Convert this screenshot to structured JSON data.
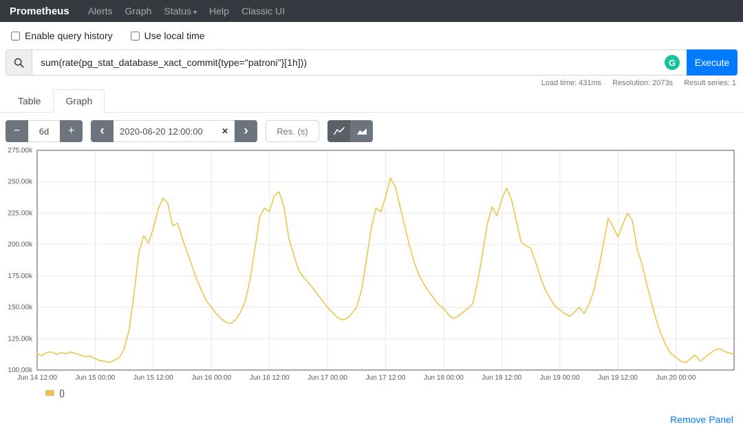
{
  "navbar": {
    "brand": "Prometheus",
    "items": [
      {
        "label": "Alerts"
      },
      {
        "label": "Graph"
      },
      {
        "label": "Status"
      },
      {
        "label": "Help"
      },
      {
        "label": "Classic UI"
      }
    ]
  },
  "options": {
    "query_history_label": "Enable query history",
    "local_time_label": "Use local time"
  },
  "query": {
    "expression": "sum(rate(pg_stat_database_xact_commit{type=\"patroni\"}[1h]))",
    "execute_label": "Execute"
  },
  "stats": {
    "load_time": "Load time: 431ms",
    "resolution": "Resolution: 2073s",
    "result_series": "Result series: 1"
  },
  "tabs": [
    {
      "label": "Table"
    },
    {
      "label": "Graph"
    }
  ],
  "controls": {
    "range_value": "6d",
    "datetime_value": "2020-06-20 12:00:00",
    "res_placeholder": "Res. (s)"
  },
  "icons": {
    "caret_down": "▾",
    "minus": "−",
    "plus": "+",
    "chevron_left": "‹",
    "chevron_right": "›",
    "clear": "✕",
    "grammarly": "G"
  },
  "legend": {
    "series_label": "{}"
  },
  "footer": {
    "remove_panel_label": "Remove Panel"
  },
  "colors": {
    "accent_blue": "#007bff",
    "series_yellow": "#edc240",
    "navbar_dark": "#343a40",
    "grammarly_green": "#15c39a"
  },
  "chart_data": {
    "type": "line",
    "title": "",
    "xlabel": "",
    "ylabel": "",
    "grid": true,
    "legend": [
      "{}"
    ],
    "xlim_hours": [
      0,
      144
    ],
    "ylim_k": [
      100,
      275
    ],
    "x_tick_hours": [
      0,
      12,
      24,
      36,
      48,
      60,
      72,
      84,
      96,
      108,
      120,
      132
    ],
    "x_tick_labels": [
      "Jun 14 12:00",
      "Jun 15 00:00",
      "Jun 15 12:00",
      "Jun 16 00:00",
      "Jun 16 12:00",
      "Jun 17 00:00",
      "Jun 17 12:00",
      "Jun 18 00:00",
      "Jun 18 12:00",
      "Jun 19 00:00",
      "Jun 19 12:00",
      "Jun 20 00:00"
    ],
    "y_ticks_k": [
      100,
      125,
      150,
      175,
      200,
      225,
      250,
      275
    ],
    "y_tick_labels": [
      "100.00k",
      "125.00k",
      "150.00k",
      "175.00k",
      "200.00k",
      "225.00k",
      "250.00k",
      "275.00k"
    ],
    "series": [
      {
        "name": "{}",
        "color": "#edc240",
        "points": [
          [
            0,
            113
          ],
          [
            1,
            111.5
          ],
          [
            2,
            114
          ],
          [
            3,
            114.5
          ],
          [
            4,
            112.5
          ],
          [
            5,
            114
          ],
          [
            6,
            113
          ],
          [
            7,
            114.5
          ],
          [
            8,
            113
          ],
          [
            9,
            112
          ],
          [
            10,
            110.5
          ],
          [
            11,
            111
          ],
          [
            12,
            109
          ],
          [
            13,
            107.5
          ],
          [
            14,
            107
          ],
          [
            15,
            106
          ],
          [
            16,
            108
          ],
          [
            17,
            110
          ],
          [
            18,
            117
          ],
          [
            19,
            132
          ],
          [
            20,
            160
          ],
          [
            21,
            193
          ],
          [
            22,
            207
          ],
          [
            23,
            201
          ],
          [
            24,
            213
          ],
          [
            25,
            228
          ],
          [
            26,
            237
          ],
          [
            27,
            233
          ],
          [
            28,
            215
          ],
          [
            29,
            217
          ],
          [
            30,
            205
          ],
          [
            31,
            194
          ],
          [
            32,
            183
          ],
          [
            33,
            172
          ],
          [
            34,
            163
          ],
          [
            35,
            155
          ],
          [
            36,
            150
          ],
          [
            37,
            145
          ],
          [
            38,
            141
          ],
          [
            39,
            138
          ],
          [
            40,
            137
          ],
          [
            41,
            140
          ],
          [
            42,
            146
          ],
          [
            43,
            155
          ],
          [
            44,
            172
          ],
          [
            45,
            197
          ],
          [
            46,
            222
          ],
          [
            47,
            229
          ],
          [
            48,
            226
          ],
          [
            49,
            239
          ],
          [
            50,
            242
          ],
          [
            51,
            230
          ],
          [
            52,
            205
          ],
          [
            53,
            192
          ],
          [
            54,
            180
          ],
          [
            55,
            174
          ],
          [
            56,
            170
          ],
          [
            57,
            165
          ],
          [
            58,
            160
          ],
          [
            59,
            155
          ],
          [
            60,
            150
          ],
          [
            61,
            146
          ],
          [
            62,
            142
          ],
          [
            63,
            140
          ],
          [
            64,
            141
          ],
          [
            65,
            145
          ],
          [
            66,
            150
          ],
          [
            67,
            163
          ],
          [
            68,
            187
          ],
          [
            69,
            212
          ],
          [
            70,
            229
          ],
          [
            71,
            226
          ],
          [
            72,
            238
          ],
          [
            73,
            253
          ],
          [
            74,
            246
          ],
          [
            75,
            230
          ],
          [
            76,
            214
          ],
          [
            77,
            198
          ],
          [
            78,
            185
          ],
          [
            79,
            175
          ],
          [
            80,
            168
          ],
          [
            81,
            162
          ],
          [
            82,
            157
          ],
          [
            83,
            152
          ],
          [
            84,
            149
          ],
          [
            85,
            144
          ],
          [
            86,
            141
          ],
          [
            87,
            143
          ],
          [
            88,
            146
          ],
          [
            89,
            149
          ],
          [
            90,
            153
          ],
          [
            91,
            170
          ],
          [
            92,
            192
          ],
          [
            93,
            216
          ],
          [
            94,
            230
          ],
          [
            95,
            223
          ],
          [
            96,
            236
          ],
          [
            97,
            245
          ],
          [
            98,
            236
          ],
          [
            99,
            219
          ],
          [
            100,
            202
          ],
          [
            101,
            199
          ],
          [
            102,
            197
          ],
          [
            103,
            186
          ],
          [
            104,
            174
          ],
          [
            105,
            164
          ],
          [
            106,
            157
          ],
          [
            107,
            151
          ],
          [
            108,
            148
          ],
          [
            109,
            145
          ],
          [
            110,
            143
          ],
          [
            111,
            146
          ],
          [
            112,
            150
          ],
          [
            113,
            145
          ],
          [
            114,
            152
          ],
          [
            115,
            163
          ],
          [
            116,
            180
          ],
          [
            117,
            200
          ],
          [
            118,
            221
          ],
          [
            119,
            214
          ],
          [
            120,
            206
          ],
          [
            121,
            216
          ],
          [
            122,
            225
          ],
          [
            123,
            219
          ],
          [
            124,
            196
          ],
          [
            125,
            184
          ],
          [
            126,
            168
          ],
          [
            127,
            153
          ],
          [
            128,
            139
          ],
          [
            129,
            128
          ],
          [
            130,
            119
          ],
          [
            131,
            113
          ],
          [
            132,
            110
          ],
          [
            133,
            107
          ],
          [
            134,
            106
          ],
          [
            135,
            109
          ],
          [
            136,
            112
          ],
          [
            137,
            107
          ],
          [
            138,
            110
          ],
          [
            139,
            113
          ],
          [
            140,
            116
          ],
          [
            141,
            117
          ],
          [
            142,
            115
          ],
          [
            143,
            113.5
          ],
          [
            144,
            113
          ]
        ]
      }
    ]
  }
}
